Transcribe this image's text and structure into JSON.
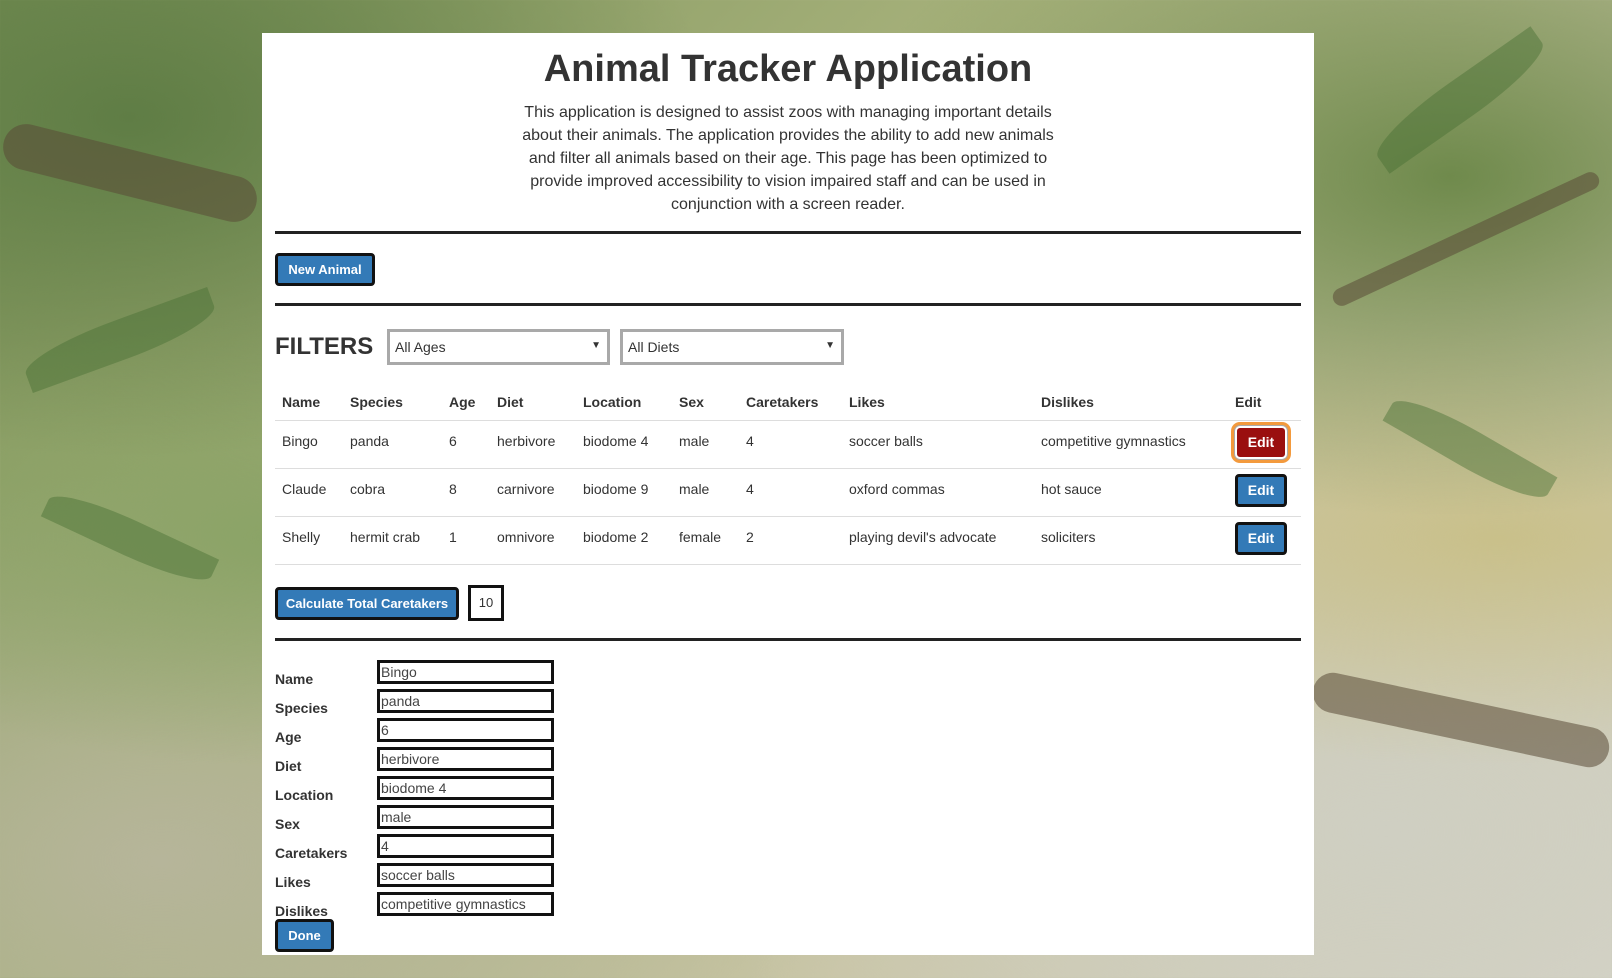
{
  "header": {
    "title": "Animal Tracker Application",
    "intro": "This application is designed to assist zoos with managing important details about their animals. The application provides the ability to add new animals and filter all animals based on their age. This page has been optimized to provide improved accessibility to vision impaired staff and can be used in conjunction with a screen reader."
  },
  "actions": {
    "new_animal_label": "New Animal"
  },
  "filters": {
    "title": "FILTERS",
    "age_selected": "All Ages",
    "diet_selected": "All Diets"
  },
  "table": {
    "headers": [
      "Name",
      "Species",
      "Age",
      "Diet",
      "Location",
      "Sex",
      "Caretakers",
      "Likes",
      "Dislikes",
      "Edit"
    ],
    "rows": [
      {
        "name": "Bingo",
        "species": "panda",
        "age": "6",
        "diet": "herbivore",
        "location": "biodome 4",
        "sex": "male",
        "caretakers": "4",
        "likes": "soccer balls",
        "dislikes": "competitive gymnastics",
        "edit_label": "Edit"
      },
      {
        "name": "Claude",
        "species": "cobra",
        "age": "8",
        "diet": "carnivore",
        "location": "biodome 9",
        "sex": "male",
        "caretakers": "4",
        "likes": "oxford commas",
        "dislikes": "hot sauce",
        "edit_label": "Edit"
      },
      {
        "name": "Shelly",
        "species": "hermit crab",
        "age": "1",
        "diet": "omnivore",
        "location": "biodome 2",
        "sex": "female",
        "caretakers": "2",
        "likes": "playing devil's advocate",
        "dislikes": "soliciters",
        "edit_label": "Edit"
      }
    ]
  },
  "caretakers": {
    "button_label": "Calculate Total Caretakers",
    "total": "10"
  },
  "edit_form": {
    "fields": [
      {
        "label": "Name",
        "value": "Bingo"
      },
      {
        "label": "Species",
        "value": "panda"
      },
      {
        "label": "Age",
        "value": "6"
      },
      {
        "label": "Diet",
        "value": "herbivore"
      },
      {
        "label": "Location",
        "value": "biodome 4"
      },
      {
        "label": "Sex",
        "value": "male"
      },
      {
        "label": "Caretakers",
        "value": "4"
      },
      {
        "label": "Likes",
        "value": "soccer balls"
      },
      {
        "label": "Dislikes",
        "value": "competitive gymnastics"
      }
    ],
    "done_label": "Done"
  },
  "colors": {
    "primary": "#337ab7",
    "active_edit": "#9a0f0f",
    "focus_ring": "#f39a3d"
  },
  "icons": {
    "select_caret": "caret-down-icon"
  }
}
